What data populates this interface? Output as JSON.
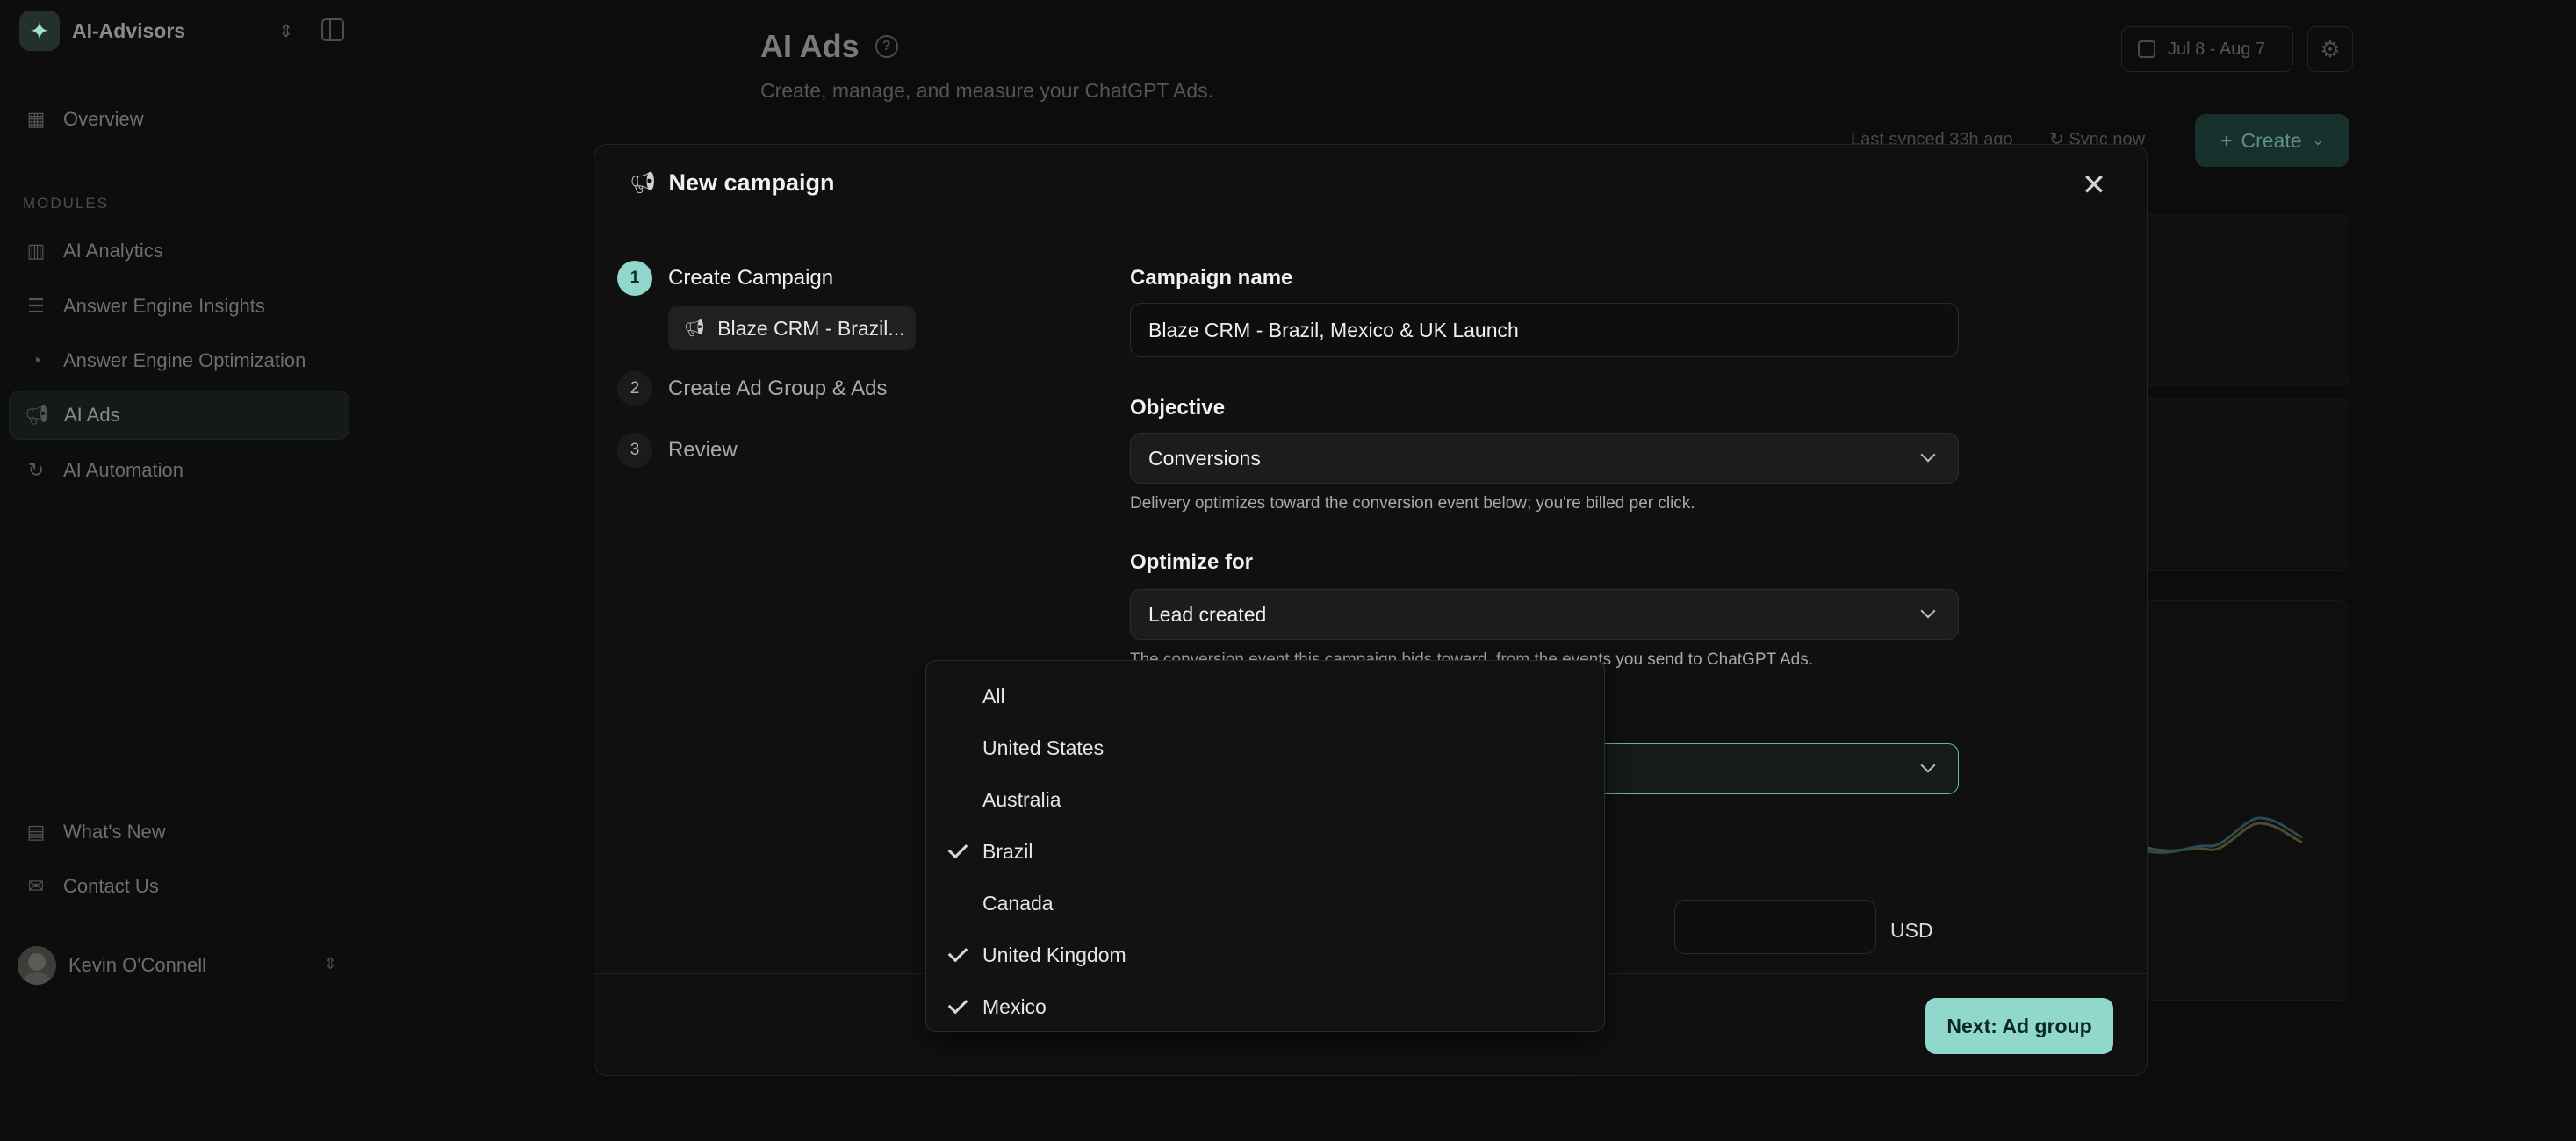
{
  "sidebar": {
    "brand": "AI-Advisors",
    "overview": "Overview",
    "section_label": "MODULES",
    "items": [
      {
        "label": "AI Analytics"
      },
      {
        "label": "Answer Engine Insights"
      },
      {
        "label": "Answer Engine Optimization"
      },
      {
        "label": "AI Ads"
      },
      {
        "label": "AI Automation"
      }
    ],
    "whats_new": "What's New",
    "contact": "Contact Us",
    "user_name": "Kevin O'Connell"
  },
  "header": {
    "title": "AI Ads",
    "subtitle": "Create, manage, and measure your ChatGPT Ads.",
    "date_range": "Jul 8 - Aug 7",
    "last_synced": "Last synced 33h ago",
    "sync_now": "Sync now",
    "create": "Create"
  },
  "modal": {
    "title": "New campaign",
    "steps": [
      {
        "num": "1",
        "label": "Create Campaign"
      },
      {
        "num": "2",
        "label": "Create Ad Group & Ads"
      },
      {
        "num": "3",
        "label": "Review"
      }
    ],
    "step_chip": "Blaze CRM - Brazil...",
    "campaign_name_label": "Campaign name",
    "campaign_name_value": "Blaze CRM - Brazil, Mexico & UK Launch",
    "objective_label": "Objective",
    "objective_value": "Conversions",
    "objective_help": "Delivery optimizes toward the conversion event below; you're billed per click.",
    "optimize_label": "Optimize for",
    "optimize_value": "Lead created",
    "optimize_help": "The conversion event this campaign bids toward, from the events you send to ChatGPT Ads.",
    "currency": "USD",
    "next_button": "Next: Ad group"
  },
  "countries": {
    "options": [
      {
        "label": "All",
        "checked": false
      },
      {
        "label": "United States",
        "checked": false
      },
      {
        "label": "Australia",
        "checked": false
      },
      {
        "label": "Brazil",
        "checked": true
      },
      {
        "label": "Canada",
        "checked": false
      },
      {
        "label": "United Kingdom",
        "checked": true
      },
      {
        "label": "Mexico",
        "checked": true
      }
    ]
  }
}
